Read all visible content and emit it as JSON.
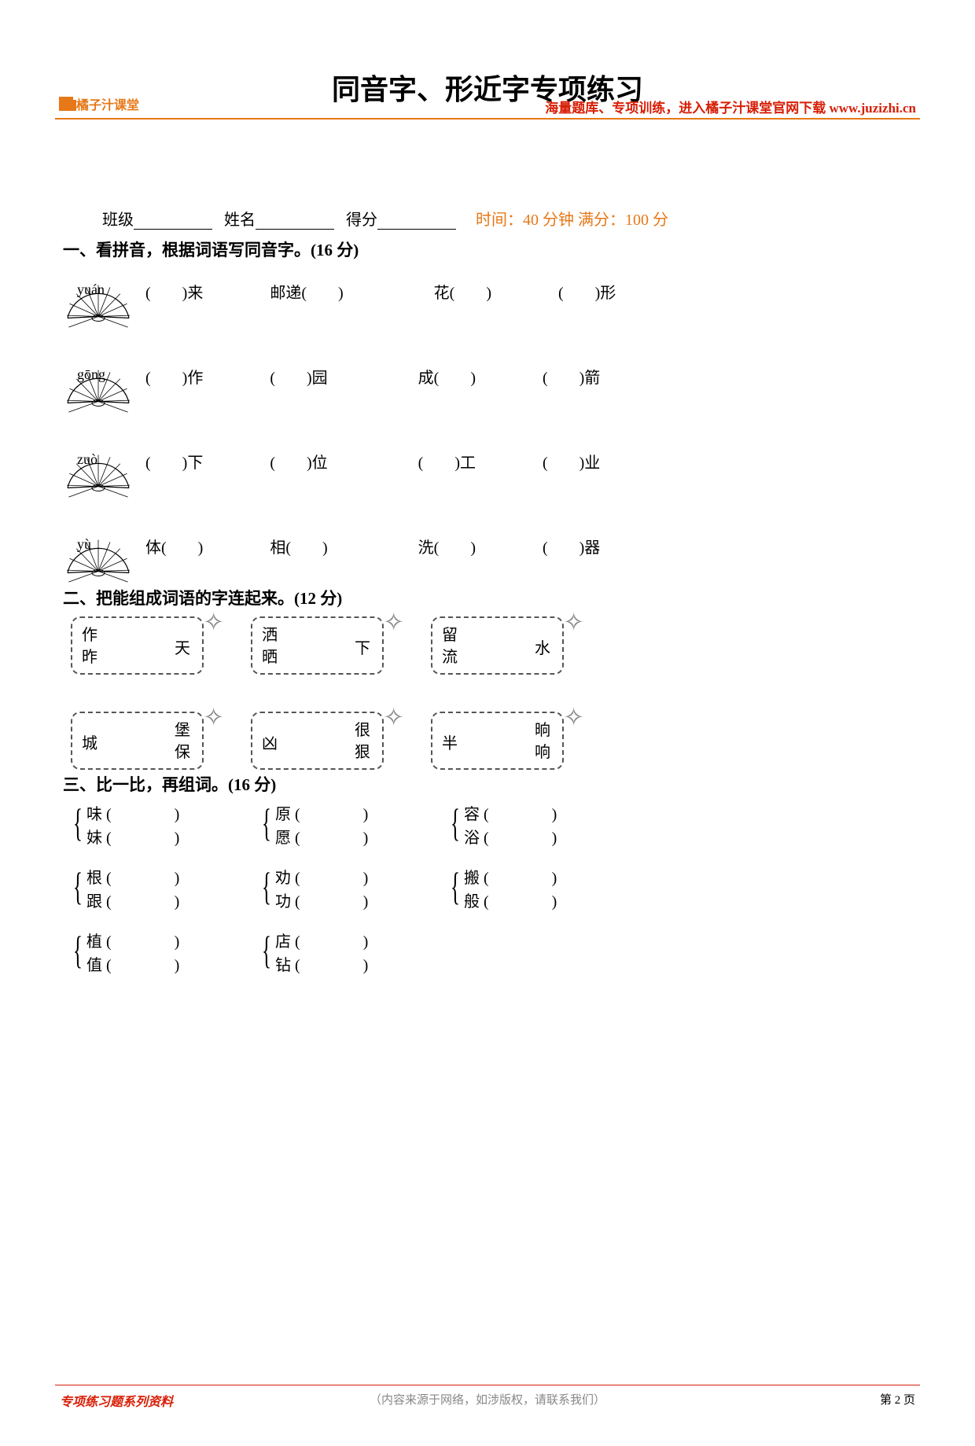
{
  "header": {
    "logo_text": "橘子汁课堂",
    "right_text": "海量题库、专项训练，进入橘子汁课堂官网下载 www.juzizhi.cn"
  },
  "title": "同音字、形近字专项练习",
  "form": {
    "class_label": "班级",
    "name_label": "姓名",
    "score_label": "得分",
    "meta": "时间：40 分钟 满分：100 分"
  },
  "section1": {
    "title": "一、看拼音，根据词语写同音字。(16 分)",
    "rows": [
      {
        "pinyin": "yuán",
        "items": [
          "(　　)来",
          "邮递(　　)",
          "花(　　)",
          "(　　)形"
        ]
      },
      {
        "pinyin": "gōng",
        "items": [
          "(　　)作",
          "(　　)园",
          "成(　　)",
          "(　　)箭"
        ]
      },
      {
        "pinyin": "zuò",
        "items": [
          "(　　)下",
          "(　　)位",
          "(　　)工",
          "(　　)业"
        ]
      },
      {
        "pinyin": "yù",
        "items": [
          "体(　　)",
          "相(　　)",
          "洗(　　)",
          "(　　)器"
        ]
      }
    ]
  },
  "section2": {
    "title": "二、把能组成词语的字连起来。(12 分)",
    "row1": [
      {
        "left": [
          "作",
          "昨"
        ],
        "right": "天"
      },
      {
        "left": [
          "洒",
          "晒"
        ],
        "right": "下"
      },
      {
        "left": [
          "留",
          "流"
        ],
        "right": "水"
      }
    ],
    "row2": [
      {
        "left": "城",
        "right": [
          "堡",
          "保"
        ]
      },
      {
        "left": "凶",
        "right": [
          "很",
          "狠"
        ]
      },
      {
        "left": "半",
        "right": [
          "晌",
          "响"
        ]
      }
    ]
  },
  "section3": {
    "title": "三、比一比，再组词。(16 分)",
    "rows": [
      [
        {
          "a": "味 (",
          "b": "妹 ("
        },
        {
          "a": "原 (",
          "b": "愿 ("
        },
        {
          "a": "容 (",
          "b": "浴 ("
        }
      ],
      [
        {
          "a": "根 (",
          "b": "跟 ("
        },
        {
          "a": "劝 (",
          "b": "功 ("
        },
        {
          "a": "搬 (",
          "b": "般 ("
        }
      ],
      [
        {
          "a": "植 (",
          "b": "值 ("
        },
        {
          "a": "店 (",
          "b": "钻 ("
        }
      ]
    ],
    "close": ")"
  },
  "footer": {
    "left": "专项练习题系列资料",
    "center": "（内容来源于网络，如涉版权，请联系我们）",
    "right": "第 2 页"
  }
}
